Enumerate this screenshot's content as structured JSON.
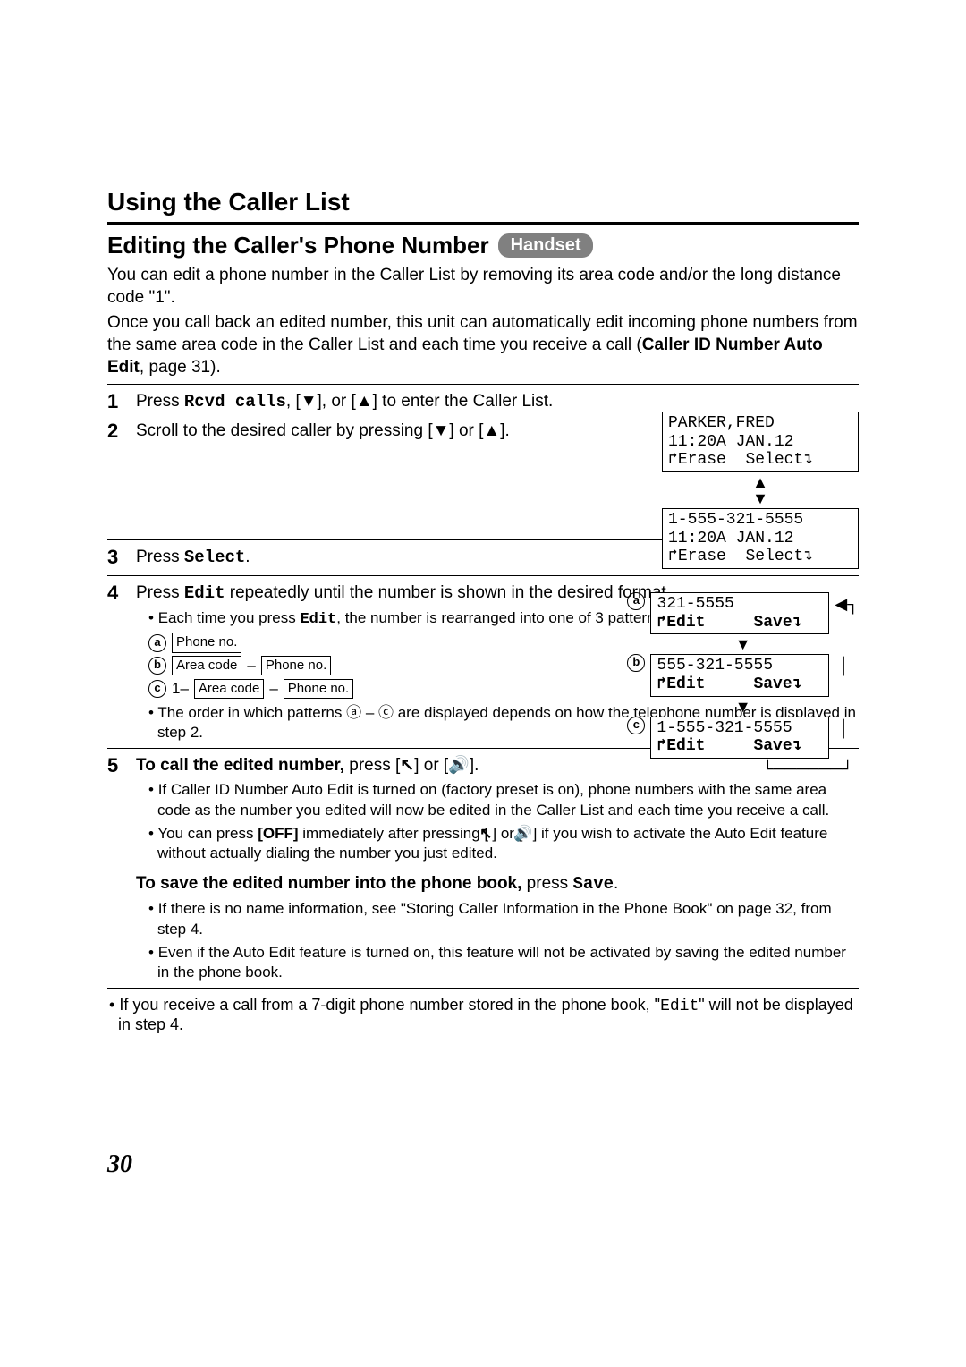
{
  "section_title": "Using the Caller List",
  "subtitle": "Editing the Caller's Phone Number",
  "badge": "Handset",
  "intro1": "You can edit a phone number in the Caller List by removing its area code and/or the long distance code \"1\".",
  "intro2_a": "Once you call back an edited number, this unit can automatically edit incoming phone numbers from the same area code in the Caller List and each time you receive a call (",
  "intro2_b": "Caller ID Number Auto Edit",
  "intro2_c": ", page 31).",
  "steps": {
    "s1": {
      "num": "1",
      "text_a": "Press ",
      "code": "Rcvd calls",
      "text_b": ", [▼], or [▲] to enter the Caller List."
    },
    "s2": {
      "num": "2",
      "text": "Scroll to the desired caller by pressing [▼] or [▲]."
    },
    "s3": {
      "num": "3",
      "text_a": "Press ",
      "code": "Select",
      "text_b": "."
    },
    "s4": {
      "num": "4",
      "text_a": "Press ",
      "code": "Edit",
      "text_b": " repeatedly until the number is shown in the desired format.",
      "bullet1_a": "Each time you press ",
      "bullet1_code": "Edit",
      "bullet1_b": ", the number is rearranged into one of 3 patterns.",
      "pa_label": "a",
      "pa_box": "Phone no.",
      "pb_label": "b",
      "pb_box1": "Area code",
      "pb_box2": "Phone no.",
      "pc_label": "c",
      "pc_prefix": "1–",
      "pc_box1": "Area code",
      "pc_box2": "Phone no.",
      "bullet2": "The order in which patterns ⓐ – ⓒ are displayed depends on how the telephone number is displayed in step 2."
    },
    "s5": {
      "num": "5",
      "lead_bold": "To call the edited number,",
      "lead_rest": " press [",
      "talk": "↖",
      "lead_mid": "] or [",
      "speaker": "🔊",
      "lead_end": "].",
      "b1_a": "If Caller ID Number Auto Edit is turned on (factory preset is on), phone numbers with the same area code as the number you edited will now be edited in the Caller List and each time you receive a call.",
      "b2_a": "You can press ",
      "b2_off": "[OFF]",
      "b2_b": " immediately after pressing [",
      "b2_c": "] or [",
      "b2_d": "] if you wish to activate the Auto Edit feature without actually dialing the number you just edited.",
      "save_lead_bold": "To save the edited number into the phone book,",
      "save_lead_rest": " press ",
      "save_code": "Save",
      "save_lead_end": ".",
      "sb1": "If there is no name information, see \"Storing Caller Information in the Phone Book\" on page 32, from step 4.",
      "sb2": "Even if the Auto Edit feature is turned on, this feature will not be activated by saving the edited number in the phone book."
    }
  },
  "screens2": {
    "lcd1_l1": "PARKER,FRED",
    "lcd1_l2": "11:20A JAN.12",
    "lcd1_l3": "↱Erase  Select↴",
    "lcd2_l1": "1-555-321-5555",
    "lcd2_l2": "11:20A JAN.12",
    "lcd2_l3": "↱Erase  Select↴"
  },
  "screens4": {
    "a_label": "a",
    "a_l1": "321-5555",
    "a_l2": "↱Edit     Save↴",
    "b_label": "b",
    "b_l1": "555-321-5555",
    "b_l2": "↱Edit     Save↴",
    "c_label": "c",
    "c_l1": "1-555-321-5555",
    "c_l2": "↱Edit     Save↴"
  },
  "footnote_a": "If you receive a call from a 7-digit phone number stored in the phone book, \"",
  "footnote_code": "Edit",
  "footnote_b": "\" will not be displayed in step 4.",
  "page_number": "30"
}
